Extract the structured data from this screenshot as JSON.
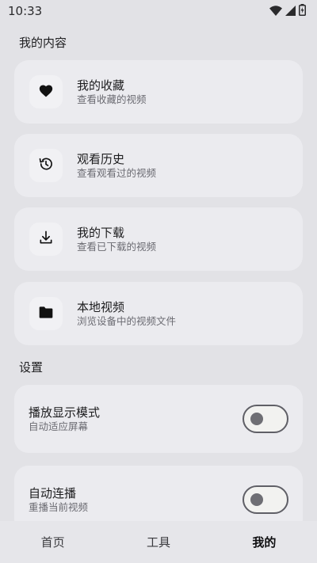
{
  "status_bar": {
    "time": "10:33",
    "icons": [
      "wifi-icon",
      "signal-icon",
      "battery-icon"
    ]
  },
  "content_section": {
    "title": "我的内容",
    "items": [
      {
        "icon": "heart-icon",
        "title": "我的收藏",
        "subtitle": "查看收藏的视频"
      },
      {
        "icon": "history-icon",
        "title": "观看历史",
        "subtitle": "查看观看过的视频"
      },
      {
        "icon": "download-icon",
        "title": "我的下载",
        "subtitle": "查看已下载的视频"
      },
      {
        "icon": "folder-icon",
        "title": "本地视频",
        "subtitle": "浏览设备中的视频文件"
      }
    ]
  },
  "settings_section": {
    "title": "设置",
    "items": [
      {
        "title": "播放显示模式",
        "subtitle": "自动适应屏幕",
        "enabled": false
      },
      {
        "title": "自动连播",
        "subtitle": "重播当前视频",
        "enabled": false
      }
    ]
  },
  "bottom_nav": {
    "items": [
      {
        "label": "首页",
        "active": false
      },
      {
        "label": "工具",
        "active": false
      },
      {
        "label": "我的",
        "active": true
      }
    ]
  },
  "colors": {
    "background": "#e2e2e6",
    "card": "#ebebef",
    "icon_box": "#f1f1f4",
    "toggle_track": "#f2f2f0",
    "toggle_border": "#5f5f66"
  }
}
